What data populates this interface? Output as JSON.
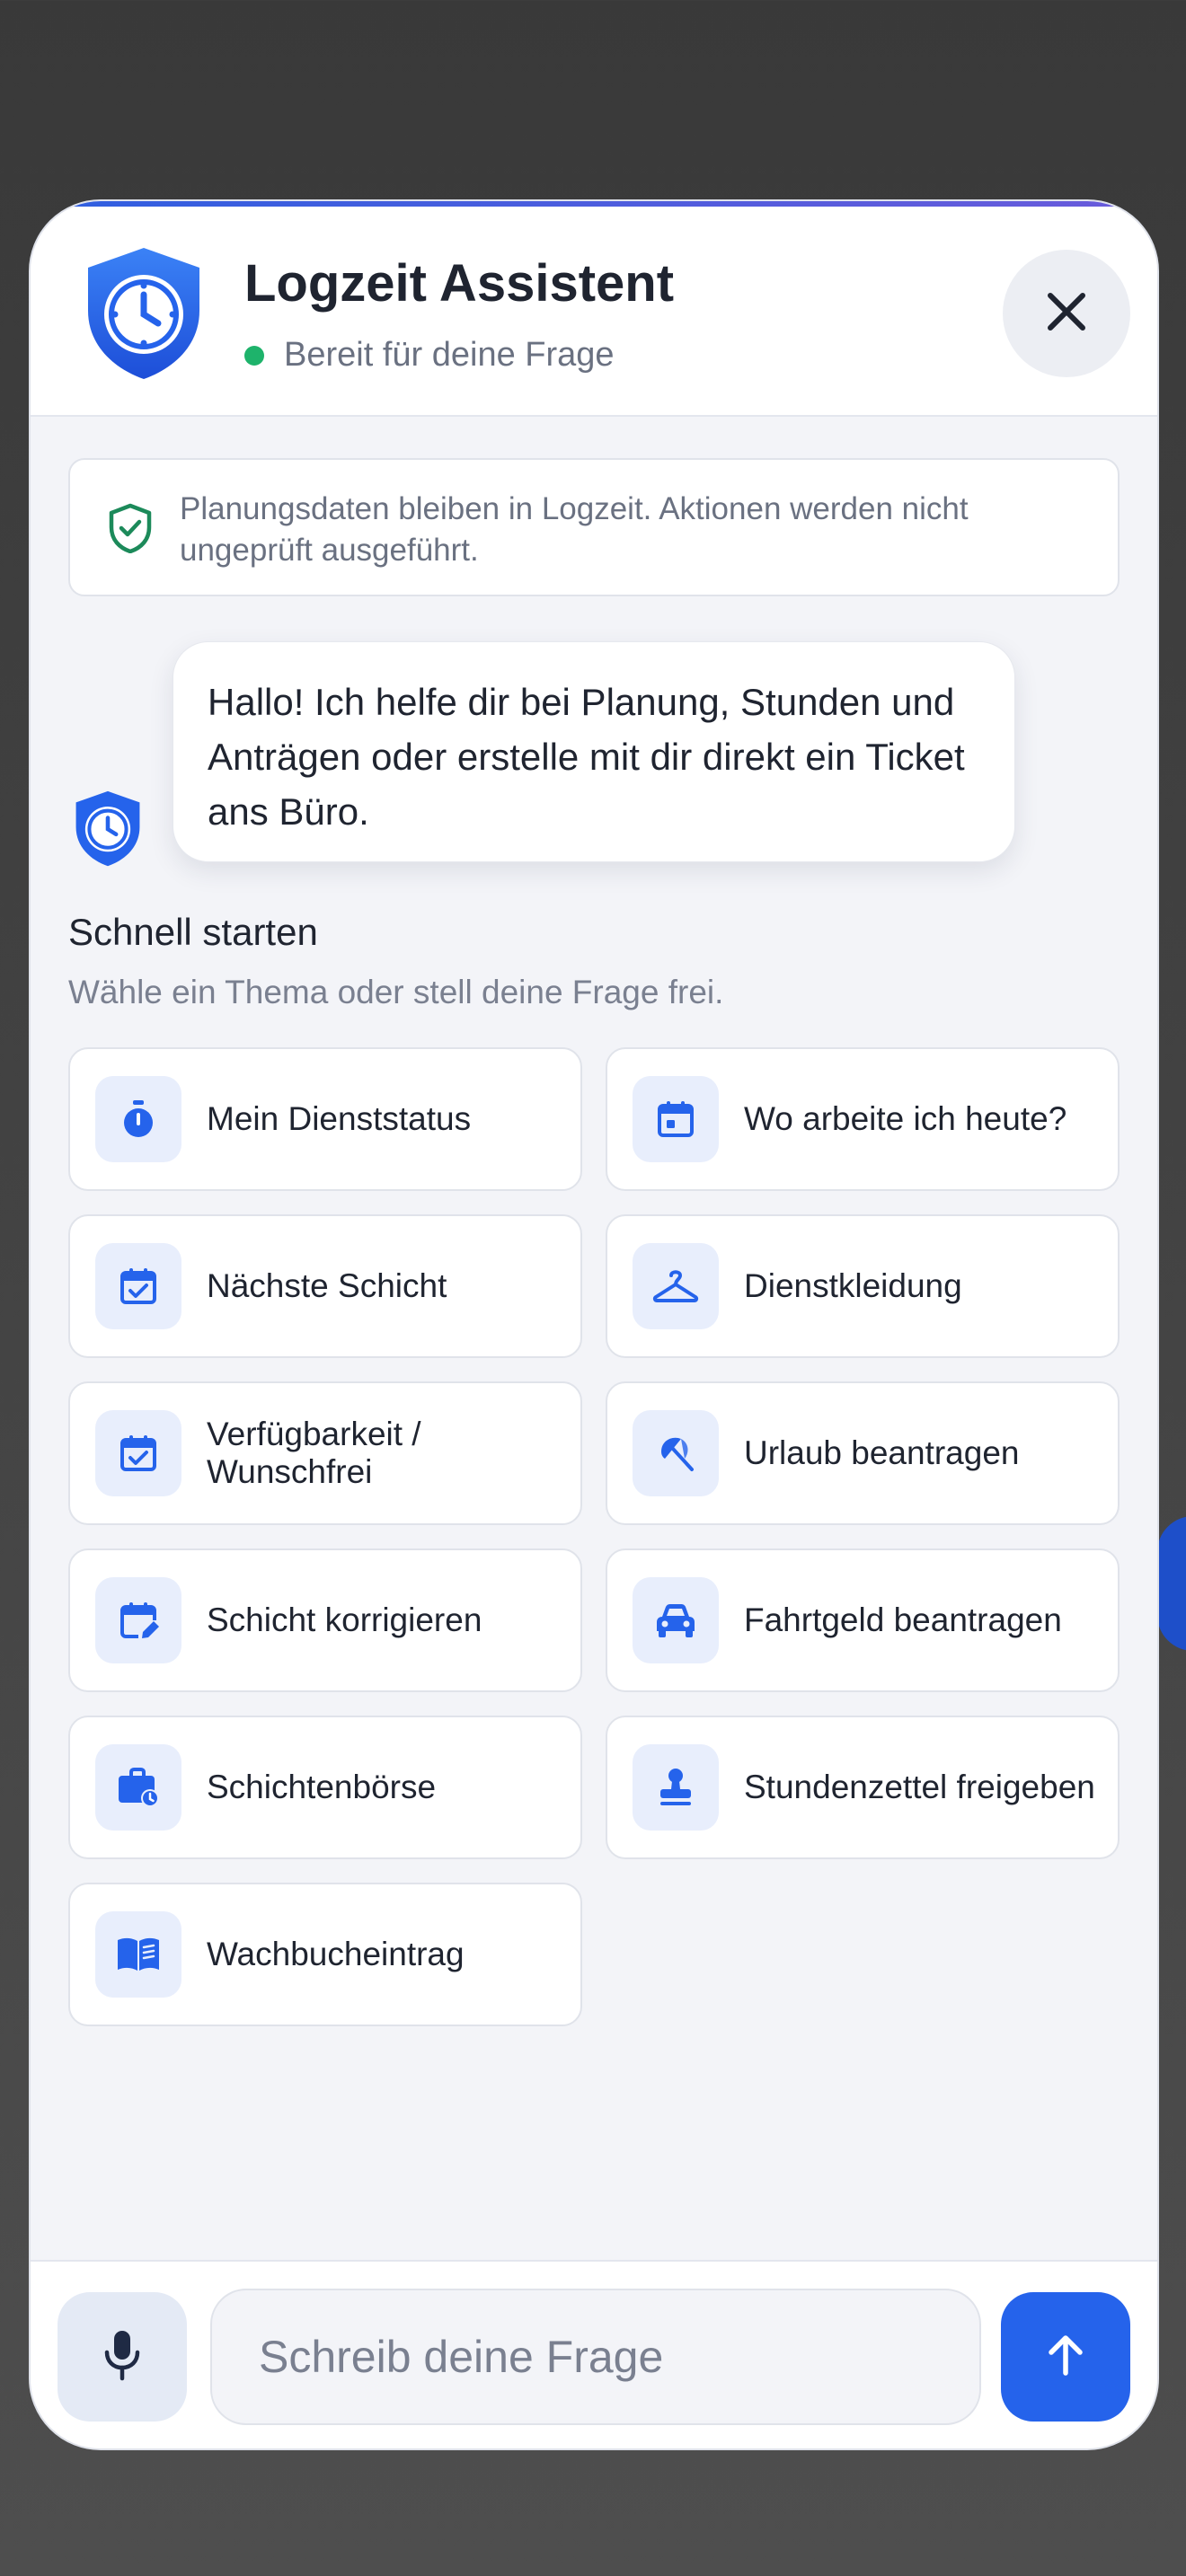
{
  "colors": {
    "accent": "#2563eb",
    "status_online": "#1eb36b",
    "notice_icon": "#1c8a5a"
  },
  "header": {
    "title": "Logzeit Assistent",
    "status": "Bereit für deine Frage",
    "logo_icon": "shield-clock-icon",
    "close_icon": "close-icon"
  },
  "notice": {
    "icon": "shield-check-icon",
    "text": "Planungsdaten bleiben in Logzeit. Aktionen werden nicht ungeprüft ausgeführt."
  },
  "chat": {
    "messages": [
      {
        "sender": "bot",
        "text": "Hallo! Ich helfe dir bei Planung, Stunden und Anträgen oder erstelle mit dir direkt ein Ticket ans Büro."
      }
    ]
  },
  "quick_start": {
    "title": "Schnell starten",
    "subtitle": "Wähle ein Thema oder stell deine Frage frei.",
    "items": [
      {
        "label": "Mein Dienststatus",
        "icon": "stopwatch-icon"
      },
      {
        "label": "Wo arbeite ich heute?",
        "icon": "calendar-day-icon"
      },
      {
        "label": "Nächste Schicht",
        "icon": "calendar-check-icon"
      },
      {
        "label": "Dienstkleidung",
        "icon": "hanger-icon"
      },
      {
        "label": "Verfügbarkeit / Wunschfrei",
        "icon": "calendar-check-icon"
      },
      {
        "label": "Urlaub beantragen",
        "icon": "beach-umbrella-icon"
      },
      {
        "label": "Schicht korrigieren",
        "icon": "calendar-edit-icon"
      },
      {
        "label": "Fahrtgeld beantragen",
        "icon": "car-icon"
      },
      {
        "label": "Schichtenbörse",
        "icon": "briefcase-clock-icon"
      },
      {
        "label": "Stundenzettel freigeben",
        "icon": "stamp-icon"
      },
      {
        "label": "Wachbucheintrag",
        "icon": "book-icon"
      }
    ]
  },
  "composer": {
    "placeholder": "Schreib deine Frage",
    "value": "",
    "mic_icon": "microphone-icon",
    "send_icon": "arrow-up-icon"
  }
}
